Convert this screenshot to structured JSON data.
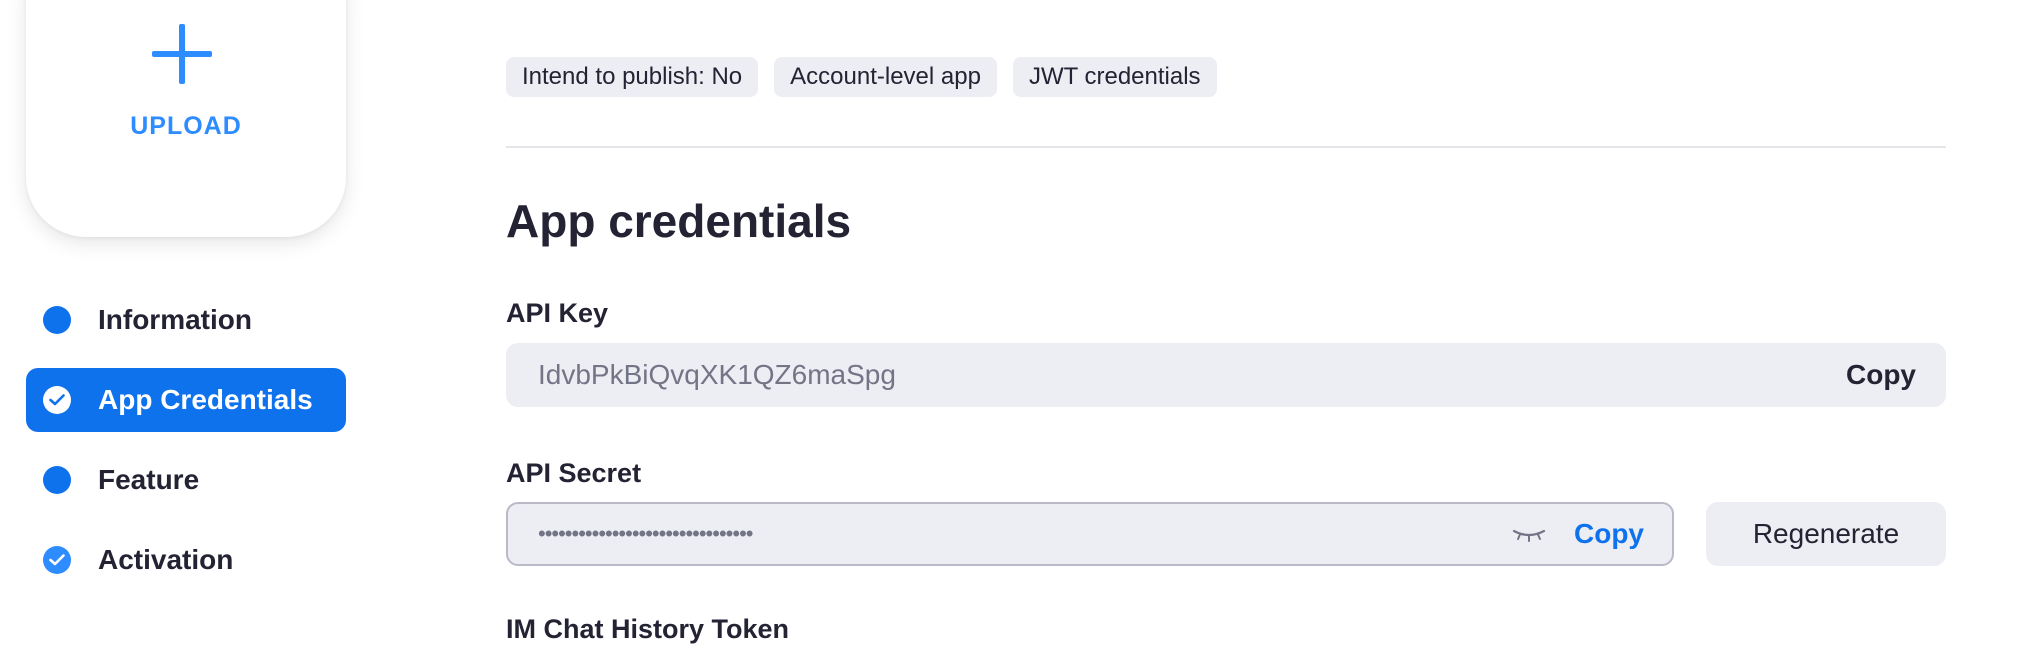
{
  "upload": {
    "label": "UPLOAD"
  },
  "sidebar": {
    "steps": [
      {
        "label": "Information",
        "state": "pending"
      },
      {
        "label": "App Credentials",
        "state": "active"
      },
      {
        "label": "Feature",
        "state": "pending"
      },
      {
        "label": "Activation",
        "state": "done"
      }
    ]
  },
  "tags": [
    "Intend to publish: No",
    "Account-level app",
    "JWT credentials"
  ],
  "credentials": {
    "title": "App credentials",
    "api_key": {
      "label": "API Key",
      "value": "IdvbPkBiQvqXK1QZ6maSpg",
      "copy_label": "Copy"
    },
    "api_secret": {
      "label": "API Secret",
      "masked_value": "••••••••••••••••••••••••••••••••",
      "copy_label": "Copy",
      "regenerate_label": "Regenerate"
    },
    "im_chat": {
      "label": "IM Chat History Token"
    }
  },
  "colors": {
    "accent": "#0e72ed",
    "accent_light": "#2d8cff",
    "field_bg": "#ededf4",
    "text": "#232333",
    "muted": "#747487"
  },
  "icons": {
    "upload": "plus-icon",
    "step_pending": "dot-icon",
    "step_done": "check-circle-icon",
    "secret_visibility": "eye-closed-icon"
  }
}
